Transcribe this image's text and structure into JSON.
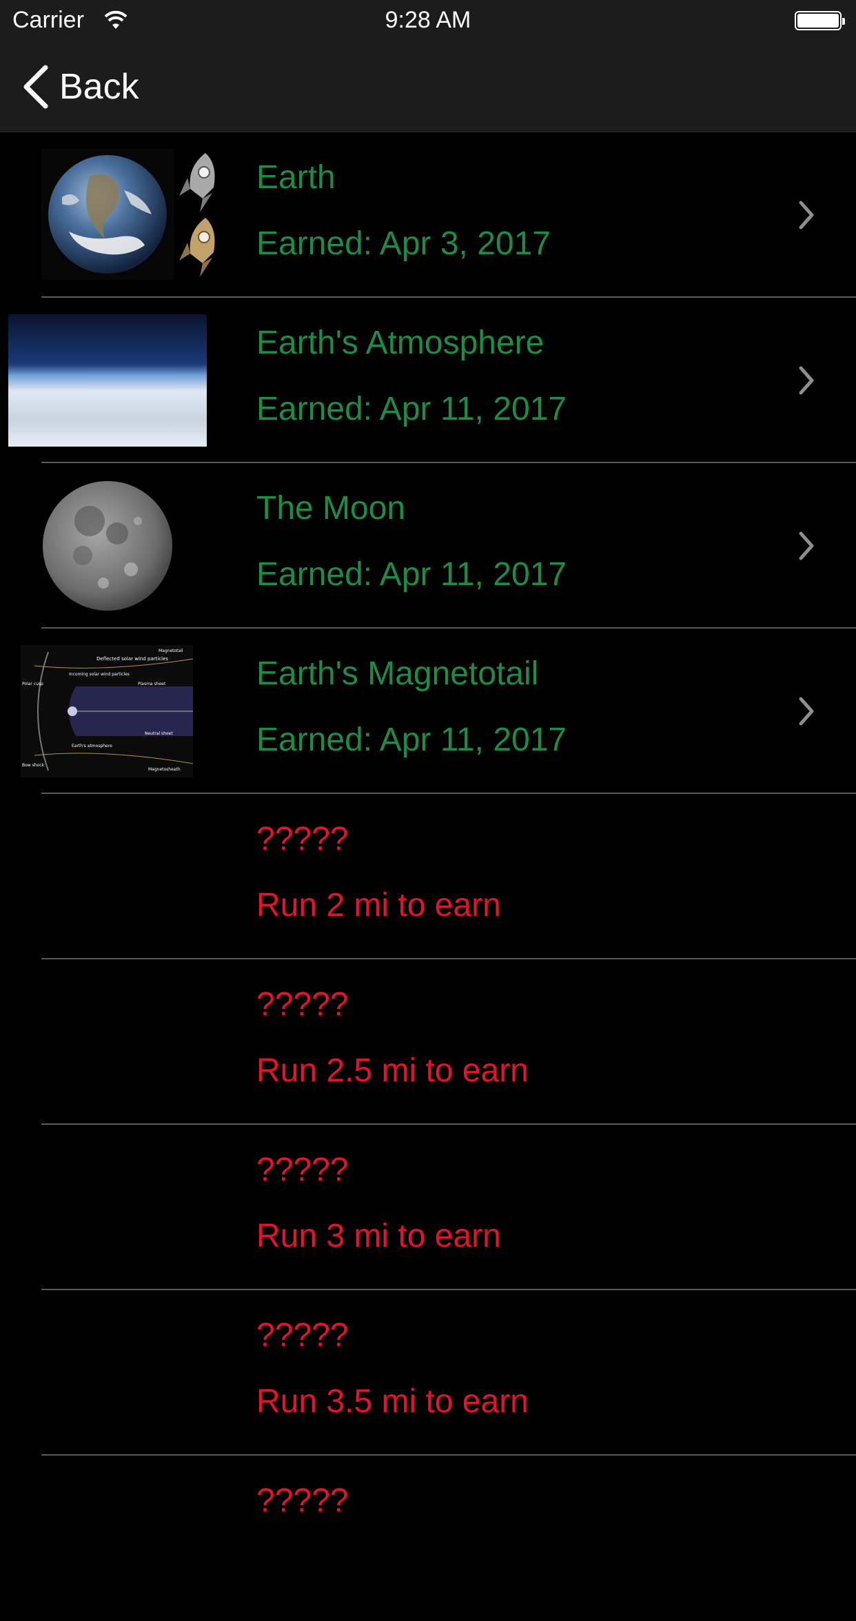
{
  "status_bar": {
    "carrier": "Carrier",
    "time": "9:28 AM"
  },
  "nav": {
    "back_label": "Back"
  },
  "colors": {
    "earned": "#1c8c46",
    "locked": "#e4122a",
    "bar": "#1c1c1c"
  },
  "badges": [
    {
      "title": "Earth",
      "subtitle": "Earned: Apr 3, 2017",
      "status": "earned",
      "image": "earth-photo"
    },
    {
      "title": "Earth's Atmosphere",
      "subtitle": "Earned: Apr 11, 2017",
      "status": "earned",
      "image": "atmosphere-photo"
    },
    {
      "title": "The Moon",
      "subtitle": "Earned: Apr 11, 2017",
      "status": "earned",
      "image": "moon-photo"
    },
    {
      "title": "Earth's Magnetotail",
      "subtitle": "Earned: Apr 11, 2017",
      "status": "earned",
      "image": "magnetotail-diagram",
      "diagram_labels": [
        "Deflected solar wind particles",
        "Magnetotail",
        "Incoming solar wind particles",
        "Polar cusp",
        "Plasma sheet",
        "Neutral sheet",
        "Earth's atmosphere",
        "Bow shock",
        "Magnetosheath"
      ]
    },
    {
      "title": "?????",
      "subtitle": "Run 2 mi to earn",
      "status": "locked"
    },
    {
      "title": "?????",
      "subtitle": "Run 2.5 mi to earn",
      "status": "locked"
    },
    {
      "title": "?????",
      "subtitle": "Run 3 mi to earn",
      "status": "locked"
    },
    {
      "title": "?????",
      "subtitle": "Run 3.5 mi to earn",
      "status": "locked"
    },
    {
      "title": "?????",
      "subtitle": "",
      "status": "locked"
    }
  ]
}
